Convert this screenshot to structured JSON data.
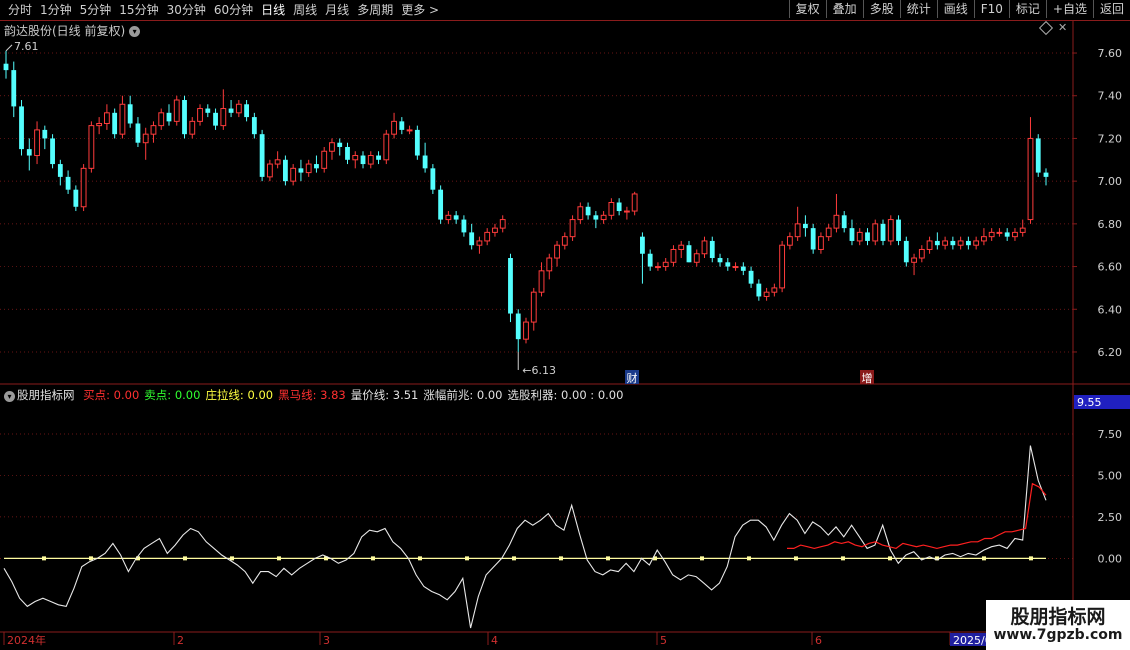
{
  "toolbar": {
    "periods": [
      "分时",
      "1分钟",
      "5分钟",
      "15分钟",
      "30分钟",
      "60分钟",
      "日线",
      "周线",
      "月线",
      "多周期",
      "更多 >"
    ],
    "active_period": "日线",
    "right_buttons": [
      "复权",
      "叠加",
      "多股",
      "统计",
      "画线",
      "F10",
      "标记",
      "+自选",
      "返回"
    ]
  },
  "main_panel": {
    "title": "韵达股份(日线 前复权)",
    "high_label": "7.61",
    "low_label": "6.13",
    "event_markers": [
      "财",
      "增"
    ],
    "price_ticks": [
      "7.60",
      "7.40",
      "7.20",
      "7.00",
      "6.80",
      "6.60",
      "6.40",
      "6.20"
    ]
  },
  "indicator_panel": {
    "name": "股朋指标网",
    "fields": [
      {
        "label": "买点:",
        "value": "0.00",
        "color": "#ff3030"
      },
      {
        "label": "卖点:",
        "value": "0.00",
        "color": "#30ff30"
      },
      {
        "label": "庄拉线:",
        "value": "0.00",
        "color": "#ffff40"
      },
      {
        "label": "黑马线:",
        "value": "3.83",
        "color": "#ff3030"
      },
      {
        "label": "量价线:",
        "value": "3.51",
        "color": "#e0e0e0"
      },
      {
        "label": "涨幅前兆:",
        "value": "0.00",
        "color": "#e0e0e0"
      },
      {
        "label": "选股利器:",
        "value": "0.00 : 0.00",
        "color": "#e0e0e0"
      }
    ],
    "current_value_box": "9.55",
    "value_ticks": [
      "7.50",
      "5.00",
      "2.50",
      "0.00"
    ]
  },
  "date_axis": {
    "labels": [
      "2024年",
      "2",
      "3",
      "4",
      "5",
      "6",
      "2025/0"
    ]
  },
  "watermark": {
    "title": "股朋指标网",
    "url": "www.7gpzb.com"
  },
  "colors": {
    "up": "#ff3c3c",
    "down": "#54ffff",
    "grid": "#8a1c1c",
    "line_white": "#e8e8e8",
    "line_red": "#ff2020",
    "line_yellow": "#fffca0"
  },
  "chart_data": [
    {
      "type": "candlestick",
      "title": "韵达股份(日线 前复权)",
      "ylim": [
        6.05,
        7.75
      ],
      "yticks": [
        7.6,
        7.4,
        7.2,
        7.0,
        6.8,
        6.6,
        6.4,
        6.2
      ],
      "x_labels": [
        "2024年",
        "2",
        "3",
        "4",
        "5",
        "6",
        "2025/0"
      ],
      "ohlc": [
        [
          7.55,
          7.61,
          7.48,
          7.52
        ],
        [
          7.52,
          7.56,
          7.3,
          7.35
        ],
        [
          7.35,
          7.38,
          7.12,
          7.15
        ],
        [
          7.15,
          7.2,
          7.05,
          7.12
        ],
        [
          7.12,
          7.28,
          7.08,
          7.24
        ],
        [
          7.24,
          7.26,
          7.15,
          7.2
        ],
        [
          7.2,
          7.22,
          7.06,
          7.08
        ],
        [
          7.08,
          7.1,
          6.98,
          7.02
        ],
        [
          7.02,
          7.05,
          6.94,
          6.96
        ],
        [
          6.96,
          6.98,
          6.86,
          6.88
        ],
        [
          6.88,
          7.08,
          6.86,
          7.06
        ],
        [
          7.06,
          7.28,
          7.04,
          7.26
        ],
        [
          7.26,
          7.3,
          7.22,
          7.27
        ],
        [
          7.27,
          7.36,
          7.24,
          7.32
        ],
        [
          7.32,
          7.34,
          7.2,
          7.22
        ],
        [
          7.22,
          7.4,
          7.2,
          7.36
        ],
        [
          7.36,
          7.4,
          7.25,
          7.27
        ],
        [
          7.27,
          7.3,
          7.16,
          7.18
        ],
        [
          7.18,
          7.25,
          7.1,
          7.22
        ],
        [
          7.22,
          7.28,
          7.18,
          7.26
        ],
        [
          7.26,
          7.34,
          7.24,
          7.32
        ],
        [
          7.32,
          7.36,
          7.26,
          7.28
        ],
        [
          7.28,
          7.4,
          7.26,
          7.38
        ],
        [
          7.38,
          7.4,
          7.2,
          7.22
        ],
        [
          7.22,
          7.3,
          7.2,
          7.28
        ],
        [
          7.28,
          7.36,
          7.26,
          7.34
        ],
        [
          7.34,
          7.36,
          7.3,
          7.32
        ],
        [
          7.32,
          7.34,
          7.24,
          7.26
        ],
        [
          7.26,
          7.43,
          7.24,
          7.34
        ],
        [
          7.34,
          7.38,
          7.3,
          7.32
        ],
        [
          7.32,
          7.38,
          7.3,
          7.36
        ],
        [
          7.36,
          7.38,
          7.28,
          7.3
        ],
        [
          7.3,
          7.32,
          7.2,
          7.22
        ],
        [
          7.22,
          7.24,
          7.0,
          7.02
        ],
        [
          7.02,
          7.1,
          7.0,
          7.08
        ],
        [
          7.08,
          7.14,
          7.06,
          7.1
        ],
        [
          7.1,
          7.12,
          6.98,
          7.0
        ],
        [
          7.0,
          7.08,
          6.98,
          7.06
        ],
        [
          7.06,
          7.1,
          7.0,
          7.04
        ],
        [
          7.04,
          7.1,
          7.02,
          7.08
        ],
        [
          7.08,
          7.12,
          7.04,
          7.06
        ],
        [
          7.06,
          7.16,
          7.04,
          7.14
        ],
        [
          7.14,
          7.2,
          7.1,
          7.18
        ],
        [
          7.18,
          7.2,
          7.12,
          7.16
        ],
        [
          7.16,
          7.18,
          7.08,
          7.1
        ],
        [
          7.1,
          7.14,
          7.06,
          7.12
        ],
        [
          7.12,
          7.14,
          7.06,
          7.08
        ],
        [
          7.08,
          7.14,
          7.06,
          7.12
        ],
        [
          7.12,
          7.14,
          7.08,
          7.1
        ],
        [
          7.1,
          7.24,
          7.08,
          7.22
        ],
        [
          7.22,
          7.32,
          7.2,
          7.28
        ],
        [
          7.28,
          7.3,
          7.22,
          7.24
        ],
        [
          7.24,
          7.26,
          7.22,
          7.24
        ],
        [
          7.24,
          7.26,
          7.1,
          7.12
        ],
        [
          7.12,
          7.18,
          7.04,
          7.06
        ],
        [
          7.06,
          7.08,
          6.94,
          6.96
        ],
        [
          6.96,
          6.98,
          6.8,
          6.82
        ],
        [
          6.82,
          6.86,
          6.8,
          6.84
        ],
        [
          6.84,
          6.86,
          6.8,
          6.82
        ],
        [
          6.82,
          6.84,
          6.74,
          6.76
        ],
        [
          6.76,
          6.8,
          6.68,
          6.7
        ],
        [
          6.7,
          6.74,
          6.66,
          6.72
        ],
        [
          6.72,
          6.78,
          6.7,
          6.76
        ],
        [
          6.76,
          6.8,
          6.74,
          6.78
        ],
        [
          6.78,
          6.84,
          6.76,
          6.82
        ],
        [
          6.64,
          6.66,
          6.34,
          6.38
        ],
        [
          6.38,
          6.4,
          6.2,
          6.26
        ],
        [
          6.26,
          6.36,
          6.24,
          6.34
        ],
        [
          6.34,
          6.5,
          6.3,
          6.48
        ],
        [
          6.48,
          6.62,
          6.46,
          6.58
        ],
        [
          6.58,
          6.66,
          6.54,
          6.64
        ],
        [
          6.64,
          6.72,
          6.6,
          6.7
        ],
        [
          6.7,
          6.76,
          6.68,
          6.74
        ],
        [
          6.74,
          6.84,
          6.72,
          6.82
        ],
        [
          6.82,
          6.9,
          6.8,
          6.88
        ],
        [
          6.88,
          6.9,
          6.82,
          6.84
        ],
        [
          6.84,
          6.86,
          6.78,
          6.82
        ],
        [
          6.82,
          6.86,
          6.8,
          6.84
        ],
        [
          6.84,
          6.92,
          6.82,
          6.9
        ],
        [
          6.9,
          6.92,
          6.84,
          6.86
        ],
        [
          6.86,
          6.88,
          6.82,
          6.86
        ],
        [
          6.86,
          6.95,
          6.84,
          6.94
        ],
        [
          6.74,
          6.76,
          6.52,
          6.66
        ],
        [
          6.66,
          6.68,
          6.58,
          6.6
        ],
        [
          6.6,
          6.62,
          6.58,
          6.6
        ],
        [
          6.6,
          6.64,
          6.58,
          6.62
        ],
        [
          6.62,
          6.7,
          6.6,
          6.68
        ],
        [
          6.68,
          6.72,
          6.64,
          6.7
        ],
        [
          6.7,
          6.72,
          6.62,
          6.62
        ],
        [
          6.62,
          6.68,
          6.6,
          6.66
        ],
        [
          6.66,
          6.74,
          6.64,
          6.72
        ],
        [
          6.72,
          6.74,
          6.62,
          6.64
        ],
        [
          6.64,
          6.66,
          6.6,
          6.62
        ],
        [
          6.62,
          6.64,
          6.58,
          6.6
        ],
        [
          6.6,
          6.62,
          6.58,
          6.6
        ],
        [
          6.6,
          6.62,
          6.56,
          6.58
        ],
        [
          6.58,
          6.6,
          6.5,
          6.52
        ],
        [
          6.52,
          6.54,
          6.44,
          6.46
        ],
        [
          6.46,
          6.5,
          6.44,
          6.48
        ],
        [
          6.48,
          6.52,
          6.46,
          6.5
        ],
        [
          6.5,
          6.72,
          6.48,
          6.7
        ],
        [
          6.7,
          6.76,
          6.68,
          6.74
        ],
        [
          6.74,
          6.88,
          6.72,
          6.8
        ],
        [
          6.8,
          6.84,
          6.74,
          6.78
        ],
        [
          6.78,
          6.8,
          6.66,
          6.68
        ],
        [
          6.68,
          6.76,
          6.66,
          6.74
        ],
        [
          6.74,
          6.8,
          6.72,
          6.78
        ],
        [
          6.78,
          6.94,
          6.76,
          6.84
        ],
        [
          6.84,
          6.86,
          6.76,
          6.78
        ],
        [
          6.78,
          6.82,
          6.7,
          6.72
        ],
        [
          6.72,
          6.78,
          6.7,
          6.76
        ],
        [
          6.76,
          6.78,
          6.7,
          6.72
        ],
        [
          6.72,
          6.82,
          6.7,
          6.8
        ],
        [
          6.8,
          6.82,
          6.7,
          6.72
        ],
        [
          6.72,
          6.84,
          6.7,
          6.82
        ],
        [
          6.82,
          6.84,
          6.7,
          6.72
        ],
        [
          6.72,
          6.74,
          6.6,
          6.62
        ],
        [
          6.62,
          6.66,
          6.56,
          6.64
        ],
        [
          6.64,
          6.7,
          6.62,
          6.68
        ],
        [
          6.68,
          6.74,
          6.66,
          6.72
        ],
        [
          6.72,
          6.76,
          6.68,
          6.7
        ],
        [
          6.7,
          6.74,
          6.68,
          6.72
        ],
        [
          6.72,
          6.74,
          6.68,
          6.7
        ],
        [
          6.7,
          6.74,
          6.68,
          6.72
        ],
        [
          6.72,
          6.74,
          6.68,
          6.7
        ],
        [
          6.7,
          6.74,
          6.68,
          6.72
        ],
        [
          6.72,
          6.78,
          6.7,
          6.74
        ],
        [
          6.74,
          6.78,
          6.72,
          6.76
        ],
        [
          6.76,
          6.78,
          6.74,
          6.76
        ],
        [
          6.76,
          6.78,
          6.72,
          6.74
        ],
        [
          6.74,
          6.78,
          6.72,
          6.76
        ],
        [
          6.76,
          6.82,
          6.74,
          6.78
        ],
        [
          6.82,
          7.3,
          6.8,
          7.2
        ],
        [
          7.2,
          7.22,
          7.02,
          7.04
        ],
        [
          7.04,
          7.06,
          6.98,
          7.02
        ]
      ]
    },
    {
      "type": "line",
      "ylim": [
        -4.2,
        9.55
      ],
      "yticks": [
        7.5,
        5.0,
        2.5,
        0.0
      ],
      "series": [
        {
          "values": [
            -0.6,
            -1.4,
            -2.4,
            -2.9,
            -2.6,
            -2.4,
            -2.6,
            -2.8,
            -2.9,
            -1.8,
            -0.5,
            -0.2,
            0.0,
            0.3,
            0.9,
            0.2,
            -0.8,
            0.0,
            0.6,
            0.9,
            1.2,
            0.3,
            0.8,
            1.4,
            1.8,
            1.6,
            1.0,
            0.6,
            0.2,
            -0.1,
            -0.4,
            -0.8,
            -1.5,
            -0.8,
            -0.8,
            -1.1,
            -0.6,
            -1.0,
            -0.6,
            -0.3,
            0.0,
            0.2,
            0.0,
            -0.3,
            -0.1,
            0.3,
            1.3,
            1.7,
            1.6,
            1.8,
            1.0,
            0.6,
            0.0,
            -1.0,
            -1.7,
            -2.0,
            -2.2,
            -2.5,
            -2.0,
            -1.2,
            -4.2,
            -2.3,
            -1.0,
            -0.5,
            0.0,
            0.8,
            1.8,
            2.3,
            2.0,
            2.3,
            2.7,
            2.0,
            1.7,
            3.2,
            1.5,
            -0.1,
            -0.8,
            -1.0,
            -0.7,
            -0.8,
            -0.3,
            -0.8,
            0.0,
            -0.4,
            0.5,
            -0.2,
            -1.0,
            -1.3,
            -1.0,
            -1.1,
            -1.5,
            -1.9,
            -1.5,
            -0.5,
            1.3,
            2.0,
            2.3,
            2.3,
            1.9,
            1.1,
            2.0,
            2.7,
            2.3,
            1.5,
            2.2,
            1.9,
            1.4,
            1.9,
            1.3,
            2.0,
            1.3,
            0.6,
            0.8,
            2.0,
            0.5,
            -0.3,
            0.2,
            0.4,
            -0.1,
            0.1,
            -0.1,
            0.2,
            0.3,
            0.1,
            0.3,
            0.2,
            0.5,
            0.7,
            0.8,
            0.6,
            1.2,
            1.1,
            6.8,
            4.7,
            3.5
          ]
        },
        {
          "values": [
            0.6,
            0.6,
            0.8,
            0.7,
            0.6,
            0.7,
            0.8,
            1.0,
            0.9,
            1.0,
            0.8,
            0.7,
            0.9,
            1.0,
            0.8,
            0.7,
            0.6,
            0.9,
            0.8,
            0.7,
            0.8,
            0.7,
            0.6,
            0.7,
            0.8,
            0.8,
            0.9,
            1.0,
            1.0,
            1.2,
            1.2,
            1.4,
            1.6,
            1.6,
            1.7,
            1.8,
            4.5,
            4.3,
            3.8
          ]
        },
        {
          "values": [
            0.0
          ]
        }
      ]
    }
  ]
}
